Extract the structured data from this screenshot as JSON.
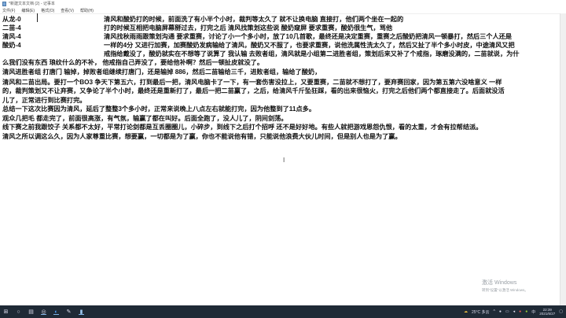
{
  "window": {
    "title": "*新建文本文档 (2) - 记事本"
  },
  "menu": [
    "文件(F)",
    "编辑(E)",
    "格式(O)",
    "查看(V)",
    "帮助(H)"
  ],
  "scores": [
    "从龙-0",
    "二苗-4",
    "清风-4",
    "酸奶-4"
  ],
  "indented_lines": [
    "清风和酸奶打的时候，前面洗了有小半个小时，裁判等太久了 就不让换电脑 直接打，他们两个坐在一起的",
    "打的时候互相把电脑屏幕掰过去，打完之后 清风找策划这些说 酸奶窥屏 要求重赛，酸奶很生气，骂他",
    "清风找秋雨雨跟策划沟通 要求重赛，讨论了小一个多小时，放了10几首歌，最终还是决定重赛，重赛之后酸奶把清风一顿暴打，然后三个人还是",
    "一样的4分 又进行加赛，加赛酸奶发病输给了清风，酸奶又不服了，也要求重赛，说他洗属性洗太久了，然后又扯了半个多小时皮，中途清风又把",
    "戒指给戴没了，酸奶就实在不想等了说算了 我认输 去败者组，清风就是小组第二进胜者组，策划后来又补了个戒指，琢磨没满的，二苗就说，为什"
  ],
  "lines": [
    "么我们没有东西 琅纹什么的不补， 他戒指自己弄没了，要给他补啊？然后一顿扯皮就没了。",
    "清风进胜者组 打唐门 输掉，掉败者组继续打唐门，还是输掉 886，然后二苗输给三千，进败者组，输给了酸奶，",
    "清风和二苗出局。要打一个BO3 争天下第五六，打到最后一把，清风电脑卡了一下，有一套伤害没拉上，又要重赛，二苗就不想打了，要弃赛回家，因为第五第六没啥意义 一样",
    "的，裁判策划又不让弃赛，又争论了半个小时，最终还是重新打了，最后一把二苗赢了，之后，给清风千斤坠狂踩，看的出来很恼火，打完之后他们两个都直接走了。后面就没活",
    "儿了，正常进行到比赛打完。",
    "总结一下这次比赛因为清风，延后了整整3个多小时，正常来说晚上八点左右就能打完，因为他整到了11点多。",
    "观众几把毛 都走完了，前面很高涨，有气氛，输赢了都在叫好。后面全跑了，没人儿了，阴间剑荡。",
    "线下赛之前我跟饺子 关系都不太好，平常打论剑都是互丢圈圈儿，小碎步，到线下之后打个招呼 还不是好好地。有些人就把游戏恩怨仇恨，看的太重，才会有拉帮结派。",
    "清风之所以调这么久，因为人家尊重比赛，想要赢，一切都是为了赢，你也不能说他有错，只能说他浪费大伙儿时间，但是别人也是为了赢。"
  ],
  "watermark": {
    "title": "激活 Windows",
    "sub": "转到\"设置\"以激活 Windows。"
  },
  "taskbar": {
    "weather": "25°C 多云",
    "input": "中",
    "time": "22:39",
    "date": "2021/6/27"
  }
}
